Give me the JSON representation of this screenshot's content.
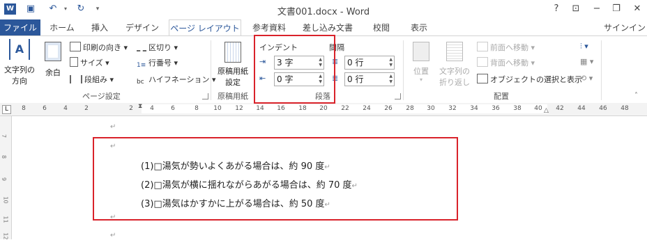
{
  "window": {
    "title": "文書001.docx - Word",
    "help": "?",
    "colors": {
      "accent": "#2b579a",
      "highlight": "#d9222a"
    }
  },
  "tabs": [
    "ファイル",
    "ホーム",
    "挿入",
    "デザイン",
    "ページ レイアウト",
    "参考資料",
    "差し込み文書",
    "校閲",
    "表示"
  ],
  "signin": "サインイン",
  "ribbon": {
    "page_setup": {
      "label": "ページ設定",
      "text_direction": [
        "文字列の",
        "方向"
      ],
      "margins": "余白",
      "orientation": "印刷の向き",
      "size": "サイズ",
      "columns": "段組み",
      "breaks": "区切り",
      "line_numbers": "行番号",
      "hyphenation": "ハイフネーション"
    },
    "manuscript": {
      "label": "原稿用紙",
      "button": [
        "原稿用紙",
        "設定"
      ]
    },
    "paragraph": {
      "label": "段落",
      "indent_label": "インデント",
      "spacing_label": "間隔",
      "indent_left": "3 字",
      "indent_right": "0 字",
      "spacing_before": "0 行",
      "spacing_after": "0 行"
    },
    "arrange": {
      "label": "配置",
      "position": "位置",
      "wrap_text": [
        "文字列の",
        "折り返し"
      ],
      "bring_forward": "前面へ移動",
      "send_backward": "背面へ移動",
      "selection_pane": "オブジェクトの選択と表示"
    }
  },
  "ruler": {
    "numbers": [
      "8",
      "6",
      "4",
      "2",
      "2",
      "4",
      "6",
      "8",
      "10",
      "12",
      "14",
      "16",
      "18",
      "20",
      "22",
      "24",
      "26",
      "28",
      "30",
      "32",
      "34",
      "36",
      "38",
      "40",
      "42",
      "44",
      "46",
      "48"
    ]
  },
  "vruler": {
    "numbers": [
      "7",
      "8",
      "9",
      "10",
      "11",
      "12"
    ]
  },
  "document": {
    "lines": [
      "(1)□湯気が勢いよくあがる場合は、約 90 度",
      "(2)□湯気が横に揺れながらあがる場合は、約 70 度",
      "(3)□湯気はかすかに上がる場合は、約 50 度"
    ],
    "paragraph_mark": "↵"
  }
}
